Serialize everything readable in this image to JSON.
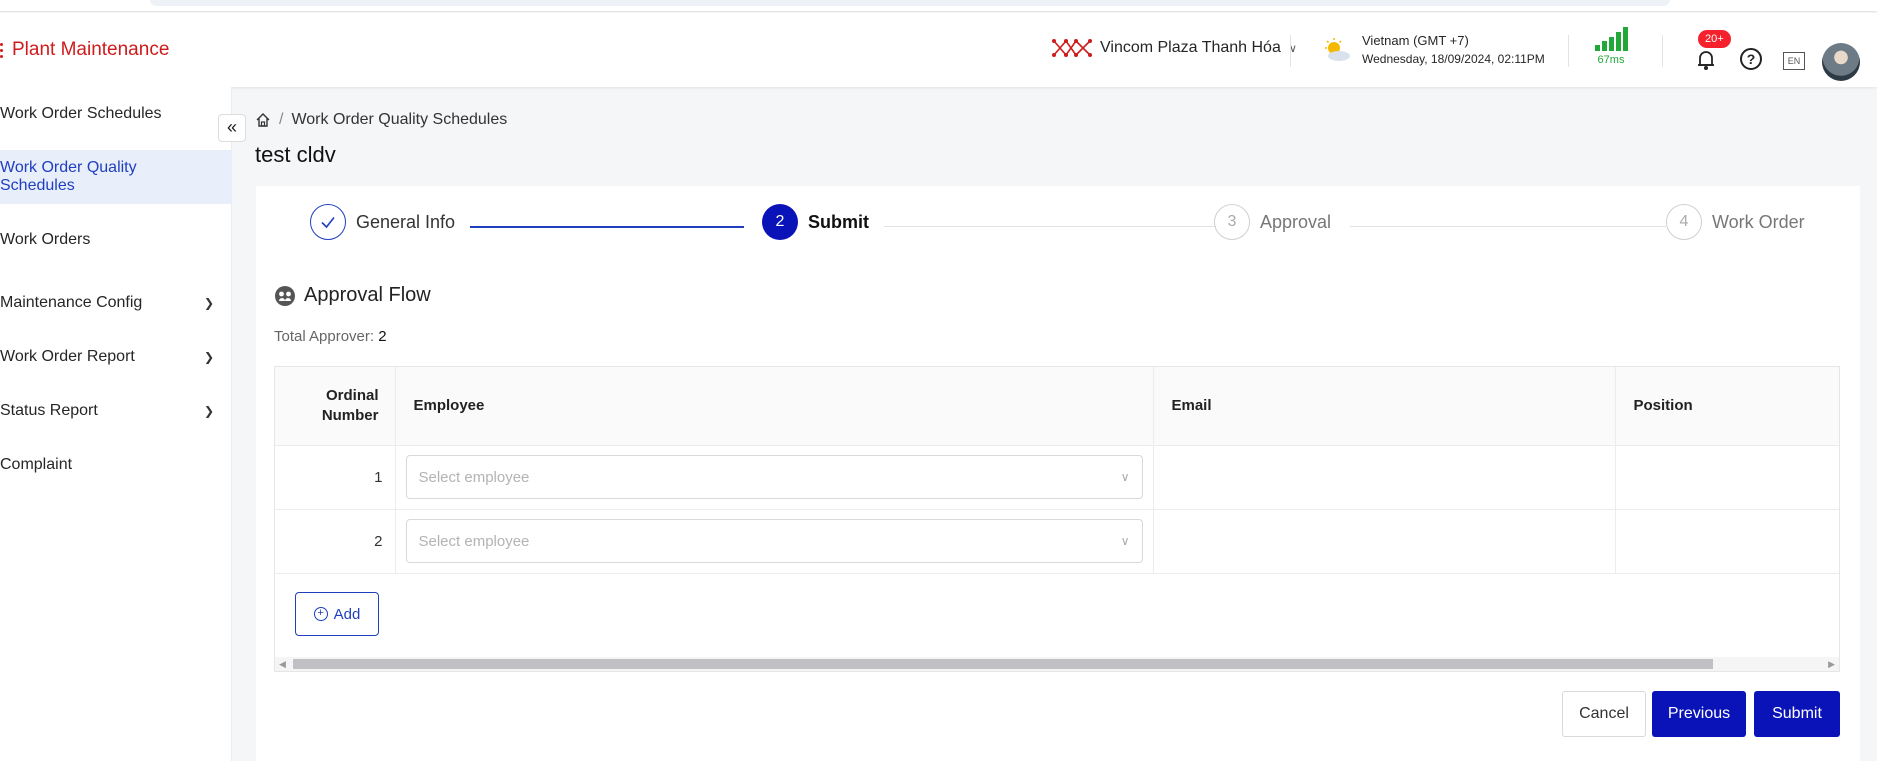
{
  "header": {
    "app_title": "Plant Maintenance",
    "site_name": "Vincom Plaza Thanh Hóa",
    "timezone": "Vietnam (GMT +7)",
    "datetime": "Wednesday, 18/09/2024, 02:11PM",
    "latency": "67ms",
    "notification_badge": "20+",
    "help_label": "?",
    "language": "EN"
  },
  "sidebar": {
    "items": [
      {
        "label": "Work Order Schedules"
      },
      {
        "label": "Work Order Quality Schedules"
      },
      {
        "label": "Work Orders"
      },
      {
        "label": "Maintenance Config"
      },
      {
        "label": "Work Order Report"
      },
      {
        "label": "Status Report"
      },
      {
        "label": "Complaint"
      }
    ],
    "active_index": 1
  },
  "breadcrumb": {
    "current": "Work Order Quality Schedules"
  },
  "page_title": "test cldv",
  "steps": [
    {
      "number": "1",
      "label": "General Info",
      "state": "done"
    },
    {
      "number": "2",
      "label": "Submit",
      "state": "current"
    },
    {
      "number": "3",
      "label": "Approval",
      "state": "wait"
    },
    {
      "number": "4",
      "label": "Work Order",
      "state": "wait"
    }
  ],
  "approval_flow": {
    "title": "Approval Flow",
    "total_label": "Total Approver:",
    "total_value": "2",
    "columns": {
      "ordinal_line1": "Ordinal",
      "ordinal_line2": "Number",
      "employee": "Employee",
      "email": "Email",
      "position": "Position"
    },
    "rows": [
      {
        "ordinal": "1",
        "employee_placeholder": "Select employee",
        "email": "",
        "position": ""
      },
      {
        "ordinal": "2",
        "employee_placeholder": "Select employee",
        "email": "",
        "position": ""
      }
    ],
    "add_label": "Add"
  },
  "actions": {
    "cancel": "Cancel",
    "previous": "Previous",
    "submit": "Submit"
  },
  "colors": {
    "brand_red": "#cf1b1b",
    "primary": "#0a13b8",
    "accent_blue": "#1f3fbf",
    "signal_green": "#22a838"
  }
}
